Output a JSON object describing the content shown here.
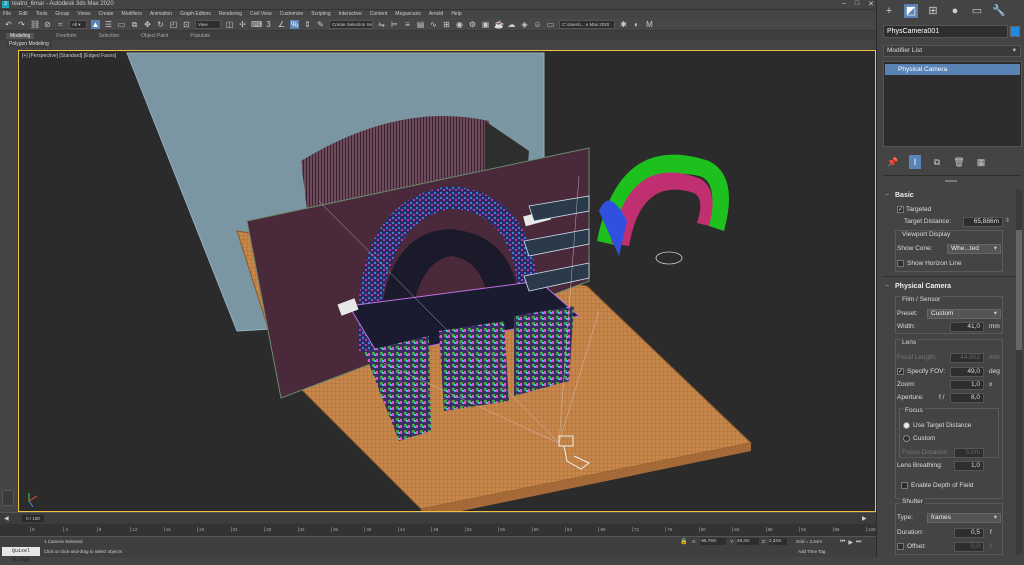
{
  "window": {
    "title": "teatro_6mar - Autodesk 3ds Max 2020",
    "min": "–",
    "max": "□",
    "close": "✕"
  },
  "menu": [
    "File",
    "Edit",
    "Tools",
    "Group",
    "Views",
    "Create",
    "Modifiers",
    "Animation",
    "Graph Editors",
    "Rendering",
    "Civil View",
    "Customize",
    "Scripting",
    "Interactive",
    "Content",
    "Megascans",
    "Arnold",
    "Help"
  ],
  "toolbar": {
    "view_dropdown": "View",
    "selection_set": "Create Selection Se",
    "workspace_path": "C:\\Users\\... e Max 2020"
  },
  "ribbon": {
    "tabs": [
      "Modeling",
      "Freeform",
      "Selection",
      "Object Paint",
      "Populate"
    ],
    "panel_label": "Polygon Modeling"
  },
  "viewport": {
    "label": "[+] [Perspective] [Standard] [Edged Faces]"
  },
  "timeline": {
    "frame": "0 / 100",
    "ticks": [
      "0",
      "2",
      "4",
      "6",
      "8",
      "10",
      "12",
      "14",
      "16",
      "18",
      "20",
      "22",
      "24",
      "26",
      "28",
      "30",
      "32",
      "34",
      "36",
      "38",
      "40",
      "42",
      "44",
      "46",
      "48",
      "50",
      "52",
      "54",
      "56",
      "58",
      "60",
      "62",
      "64",
      "66",
      "68",
      "70",
      "72",
      "74",
      "76",
      "78",
      "80",
      "82",
      "84",
      "86",
      "88",
      "90",
      "92",
      "94",
      "96",
      "98",
      "100"
    ]
  },
  "status": {
    "quick_bridge": "Quixel Bridge",
    "selection": "1 Camera Selected",
    "prompt": "Click or click-and-drag to select objects",
    "x_label": "X:",
    "x_value": "-66,78m",
    "y_label": "Y:",
    "y_value": "49,3m",
    "z_label": "Z:",
    "z_value": "2,34m",
    "grid": "Grid = 2,54m",
    "add_time_tag": "Add Time Tag"
  },
  "panel": {
    "object_name": "PhysCamera001",
    "object_color": "#1e88e5",
    "modifier_list": "Modifier List",
    "stack_item": "Physical Camera",
    "basic": {
      "title": "Basic",
      "targeted": "Targeted",
      "target_distance_label": "Target Distance:",
      "target_distance": "65,886m",
      "viewport_display": "Viewport Display",
      "show_cone_label": "Show Cone:",
      "show_cone": "Whe...ted",
      "show_horizon": "Show Horizon Line"
    },
    "physical": {
      "title": "Physical Camera",
      "film": "Film / Sensor",
      "preset_label": "Preset:",
      "preset": "Custom",
      "width_label": "Width:",
      "width": "41,0",
      "width_unit": "mm",
      "lens": "Lens",
      "focal_label": "Focal Length:",
      "focal": "44,952",
      "focal_unit": "mm",
      "fov_label": "Specify FOV:",
      "fov": "49,0",
      "fov_unit": "deg",
      "zoom_label": "Zoom:",
      "zoom": "1,0",
      "zoom_unit": "x",
      "aperture_label": "Aperture:",
      "aperture_prefix": "f /",
      "aperture": "8,0",
      "focus": "Focus",
      "use_target": "Use Target Distance",
      "custom": "Custom",
      "focus_distance_label": "Focus Distance:",
      "focus_distance": "5,0m",
      "breathing_label": "Lens Breathing:",
      "breathing": "1,0",
      "dof": "Enable Depth of Field",
      "shutter": "Shutter",
      "type_label": "Type:",
      "type": "frames",
      "duration_label": "Duration:",
      "duration": "0,5",
      "duration_unit": "f",
      "offset_label": "Offset:",
      "offset": "0,0",
      "offset_unit": "f"
    }
  }
}
